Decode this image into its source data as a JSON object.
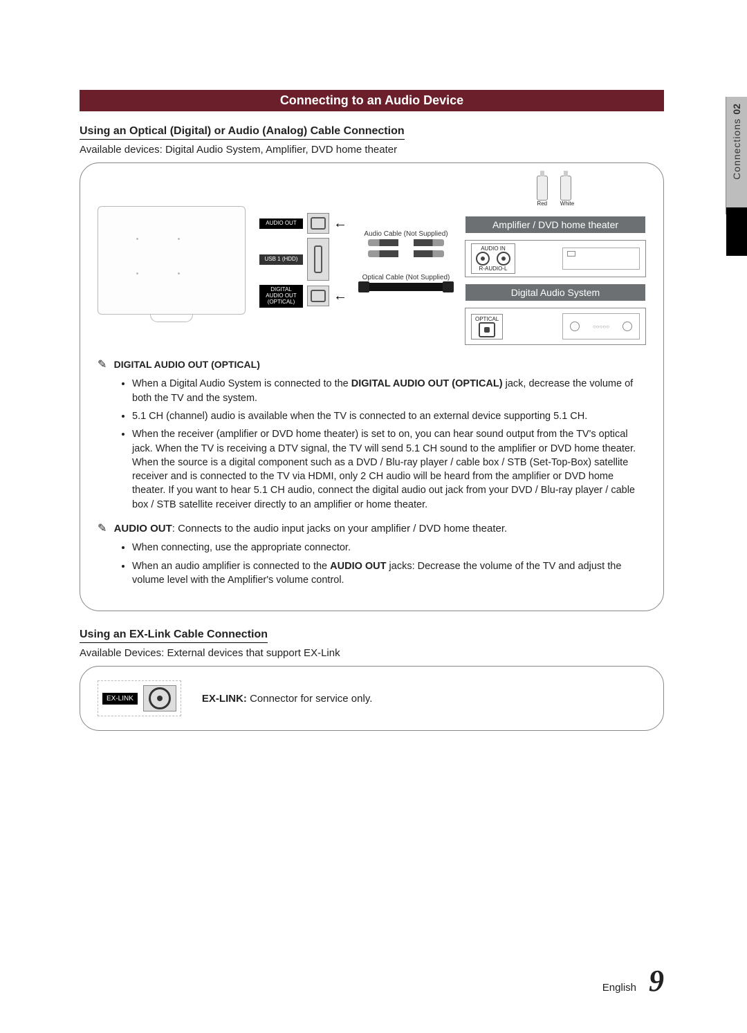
{
  "sideTab": {
    "num": "02",
    "label": "Connections"
  },
  "header": "Connecting to an Audio Device",
  "section1": {
    "heading": "Using an Optical (Digital) or Audio (Analog) Cable Connection",
    "available": "Available devices: Digital Audio System, Amplifier, DVD home theater"
  },
  "diagram": {
    "ports": {
      "audioOut": "AUDIO OUT",
      "usb": "USB 1 (HDD)",
      "digital": "DIGITAL AUDIO OUT (OPTICAL)"
    },
    "plugs": {
      "red": "Red",
      "white": "White"
    },
    "cables": {
      "audio": "Audio Cable (Not Supplied)",
      "optical": "Optical Cable (Not Supplied)"
    },
    "amp": {
      "title": "Amplifier / DVD home theater",
      "audioIn": "AUDIO IN",
      "rl": "R-AUDIO-L"
    },
    "das": {
      "title": "Digital Audio System",
      "optical": "OPTICAL"
    }
  },
  "notes": {
    "n1_title": "DIGITAL AUDIO OUT (OPTICAL)",
    "n1_items": [
      [
        "When a Digital Audio System is connected to the ",
        "DIGITAL AUDIO OUT (OPTICAL)",
        " jack, decrease the volume of both the TV and the system."
      ],
      [
        "5.1 CH (channel) audio is available when the TV is connected to an external device supporting 5.1 CH."
      ],
      [
        "When the receiver (amplifier or DVD home theater) is set to on, you can hear sound output from the TV's optical jack. When the TV is receiving a DTV signal, the TV will send 5.1 CH sound to the amplifier or DVD home theater. When the source is a digital component such as a DVD / Blu-ray player / cable box / STB (Set-Top-Box) satellite receiver and is connected to the TV via HDMI, only 2 CH audio will be heard from the amplifier or DVD home theater. If you want to hear 5.1 CH audio, connect the digital audio out jack from your DVD / Blu-ray player / cable box / STB satellite receiver directly to an amplifier or home theater."
      ]
    ],
    "n2_prefix": "AUDIO OUT",
    "n2_text": ": Connects to the audio input jacks on your amplifier / DVD home theater.",
    "n2_items": [
      [
        "When connecting, use the appropriate connector."
      ],
      [
        "When an audio amplifier is connected to the ",
        "AUDIO OUT",
        " jacks: Decrease the volume of the TV and adjust the volume level with the Amplifier's volume control."
      ]
    ]
  },
  "section2": {
    "heading": "Using an EX-Link Cable Connection",
    "available": "Available Devices: External devices that support EX-Link",
    "portLabel": "EX-LINK",
    "text_prefix": "EX-LINK:",
    "text": " Connector for service only."
  },
  "footer": {
    "lang": "English",
    "page": "9"
  }
}
